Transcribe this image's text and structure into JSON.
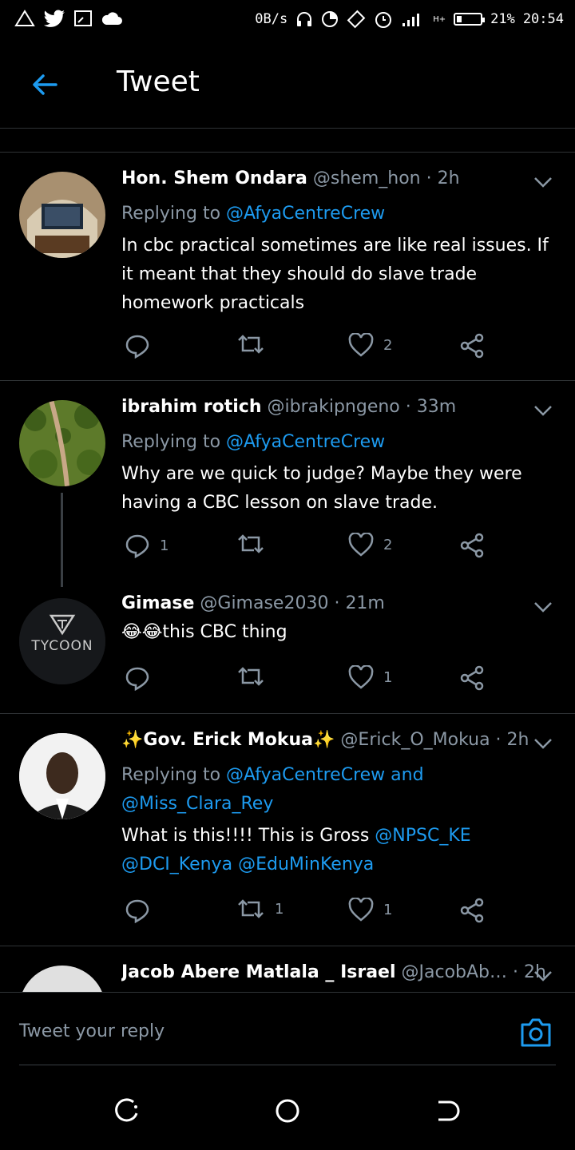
{
  "status_bar": {
    "net_speed": "0B/s",
    "battery": "21%",
    "time": "20:54",
    "net_type": "H+"
  },
  "header": {
    "title": "Tweet"
  },
  "tweets": [
    {
      "name": "Hon. Shem Ondara",
      "handle": "@shem_hon",
      "time": "2h",
      "replying_label": "Replying to",
      "replying_to": "@AfyaCentreCrew",
      "text": "In cbc practical sometimes are like real issues. If it meant that they should do slave trade homework practicals",
      "replies": "",
      "retweets": "",
      "likes": "2"
    },
    {
      "name": "ibrahim rotich",
      "handle": "@ibrakipngeno",
      "time": "33m",
      "replying_label": "Replying to",
      "replying_to": "@AfyaCentreCrew",
      "text": "Why are we quick to judge? Maybe they were having a CBC lesson on slave trade.",
      "replies": "1",
      "retweets": "",
      "likes": "2"
    },
    {
      "name": "Gimase",
      "handle": "@Gimase2030",
      "time": "21m",
      "emoji": "😂😂",
      "text": "this CBC thing",
      "avatar_text": "TYCOON",
      "replies": "",
      "retweets": "",
      "likes": "1"
    },
    {
      "name": "✨Gov. Erick Mokua✨",
      "handle": "@Erick_O_Mokua",
      "time": "2h",
      "replying_label": "Replying to",
      "replying_to": "@AfyaCentreCrew",
      "and": "and",
      "replying_to_2": "@Miss_Clara_Rey",
      "text": "What is this!!!! This is Gross",
      "mentions": [
        "@NPSC_KE",
        "@DCI_Kenya",
        "@EduMinKenya"
      ],
      "replies": "",
      "retweets": "1",
      "likes": "1"
    },
    {
      "name": "Jacob Abere Matlala _ Israel",
      "handle": "@JacobAb…",
      "time": "2h"
    }
  ],
  "composer": {
    "placeholder": "Tweet your reply"
  },
  "colors": {
    "accent": "#1d9bf0",
    "muted": "#8b98a5",
    "background": "#000000"
  }
}
